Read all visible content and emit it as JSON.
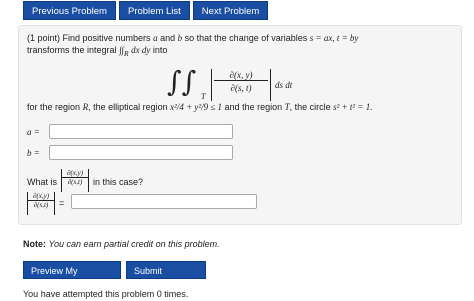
{
  "nav": {
    "previous": "Previous Problem",
    "list": "Problem List",
    "next": "Next Problem"
  },
  "problem": {
    "line1": "(1 point) Find positive numbers",
    "var_a": "a",
    "and": "and",
    "var_b": "b",
    "line1_tail": "so that the change of variables",
    "cov": "s = ax, t = by",
    "line2": "transforms the integral",
    "int_expr": "∫∫",
    "int_region": "R",
    "int_body": "dx dy",
    "into": "into",
    "jac_num": "∂(x, y)",
    "jac_den": "∂(s, t)",
    "region_T": "T",
    "ds_dt": "ds dt",
    "for_region": "for the region",
    "R": "R",
    "elliptical": ", the elliptical region",
    "ellipse_eq": "x²/4 + y²/9 ≤ 1",
    "and_region": "and the region",
    "T": "T",
    "circle_text": ", the circle",
    "circle_eq": "s² + t² = 1."
  },
  "answers": {
    "a_label": "a =",
    "b_label": "b =",
    "a_value": "",
    "b_value": ""
  },
  "question": {
    "what_is": "What is",
    "in_this_case": "in this case?",
    "jac_num": "∂(x,y)",
    "jac_den": "∂(s,t)",
    "equals": "=",
    "jac_value": ""
  },
  "note": {
    "label": "Note:",
    "text": "You can earn partial credit on this problem."
  },
  "buttons": {
    "preview": "Preview My Answers",
    "submit": "Submit Answers"
  },
  "footer": {
    "attempts": "You have attempted this problem 0 times."
  }
}
